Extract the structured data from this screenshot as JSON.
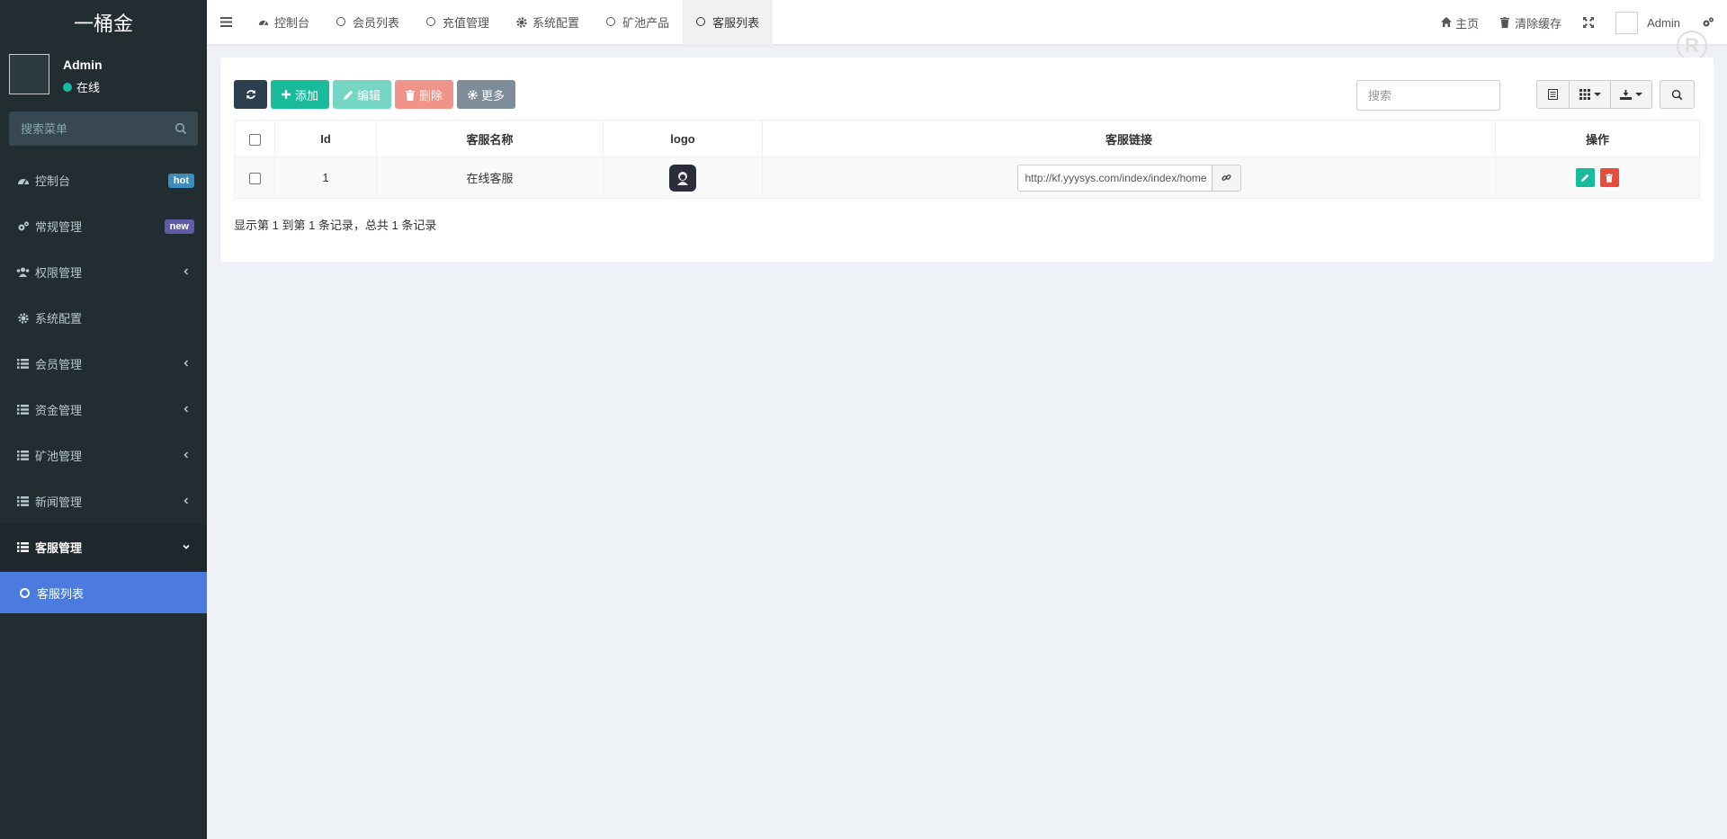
{
  "brand": "一桶金",
  "user": {
    "name": "Admin",
    "status": "在线"
  },
  "sidebar": {
    "search_placeholder": "搜索菜单",
    "items": [
      {
        "label": "控制台",
        "icon": "dashboard-icon",
        "badge": "hot",
        "badge_color": "#3c8dbc"
      },
      {
        "label": "常规管理",
        "icon": "cogs-icon",
        "badge": "new",
        "badge_color": "#605ca8"
      },
      {
        "label": "权限管理",
        "icon": "group-icon"
      },
      {
        "label": "系统配置",
        "icon": "gear-icon"
      },
      {
        "label": "会员管理",
        "icon": "list-icon"
      },
      {
        "label": "资金管理",
        "icon": "list-icon"
      },
      {
        "label": "矿池管理",
        "icon": "list-icon"
      },
      {
        "label": "新闻管理",
        "icon": "list-icon"
      },
      {
        "label": "客服管理",
        "icon": "list-icon"
      }
    ],
    "sub_items": [
      {
        "label": "客服列表"
      }
    ]
  },
  "topnav": {
    "tabs": [
      {
        "label": "控制台",
        "icon": "dashboard-icon"
      },
      {
        "label": "会员列表",
        "icon": "circle-icon"
      },
      {
        "label": "充值管理",
        "icon": "circle-icon"
      },
      {
        "label": "系统配置",
        "icon": "gear-icon"
      },
      {
        "label": "矿池产品",
        "icon": "circle-icon"
      },
      {
        "label": "客服列表",
        "icon": "circle-icon",
        "active": true
      }
    ],
    "home": "主页",
    "clear_cache": "清除缓存",
    "admin": "Admin"
  },
  "toolbar": {
    "add": "添加",
    "edit": "编辑",
    "delete": "删除",
    "more": "更多",
    "search_placeholder": "搜索"
  },
  "table": {
    "headers": {
      "id": "Id",
      "name": "客服名称",
      "logo": "logo",
      "link": "客服链接",
      "ops": "操作"
    },
    "rows": [
      {
        "id": "1",
        "name": "在线客服",
        "link": "http://kf.yyysys.com/index/index/home"
      }
    ]
  },
  "pager_text": "显示第 1 到第 1 条记录，总共 1 条记录",
  "colors": {
    "accent": "#18bc9c",
    "danger": "#e74c3c",
    "sidebar_bg": "#222d32",
    "active_submenu": "#4c7be0"
  }
}
